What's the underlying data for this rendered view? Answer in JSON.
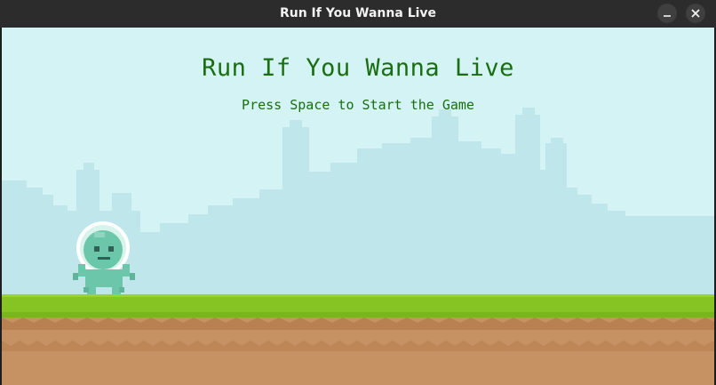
{
  "window": {
    "title": "Run If You Wanna Live"
  },
  "game": {
    "title": "Run If You Wanna Live",
    "prompt": "Press Space to Start the Game",
    "player": "astronaut-character",
    "colors": {
      "sky": "#d3f3f5",
      "skyline": "#bfe6ea",
      "grass": "#86c423",
      "dirt": "#c69163",
      "text": "#1b6e10",
      "player": "#6cc7aa"
    }
  }
}
